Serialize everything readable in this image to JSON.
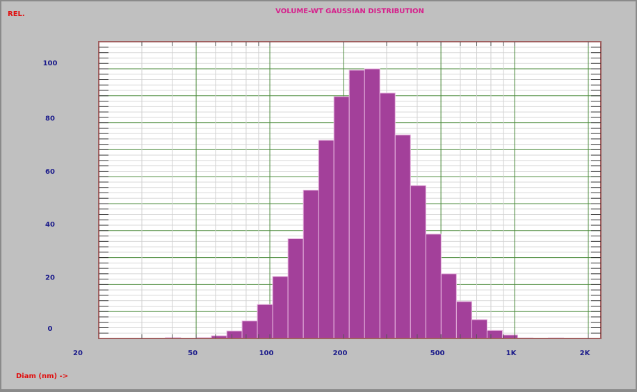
{
  "chart_data": {
    "type": "bar",
    "title": "VOLUME-WT GAUSSIAN DISTRIBUTION",
    "ylabel": "REL.",
    "xlabel": "Diam (nm) ->",
    "xscale": "log",
    "xlim": [
      20,
      2250
    ],
    "ylim": [
      0,
      110
    ],
    "yticks": [
      0,
      20,
      40,
      60,
      80,
      100
    ],
    "ytick_labels": [
      "0",
      "20",
      "40",
      "60",
      "80",
      "100"
    ],
    "xticks": [
      20,
      50,
      100,
      200,
      500,
      1000,
      2000
    ],
    "xtick_labels": [
      "20",
      "50",
      "100",
      "200",
      "500",
      "1K",
      "2K"
    ],
    "grid": true,
    "bar_color": "#a3409a",
    "title_color": "#d6208c",
    "axis_label_color": "#e01010",
    "tick_label_color": "#1a1a8a",
    "grid_major_color": "#4a8a3a",
    "bins": [
      {
        "from": 37.4,
        "to": 43.2,
        "value": 0.3
      },
      {
        "from": 50.0,
        "to": 57.7,
        "value": 0.3
      },
      {
        "from": 57.7,
        "to": 66.7,
        "value": 1.0
      },
      {
        "from": 66.7,
        "to": 77.0,
        "value": 2.8
      },
      {
        "from": 77.0,
        "to": 88.9,
        "value": 6.5
      },
      {
        "from": 88.9,
        "to": 102.7,
        "value": 12.6
      },
      {
        "from": 102.7,
        "to": 118.6,
        "value": 23.0
      },
      {
        "from": 118.6,
        "to": 137.0,
        "value": 37.0
      },
      {
        "from": 137.0,
        "to": 158.2,
        "value": 55.0
      },
      {
        "from": 158.2,
        "to": 182.7,
        "value": 73.5
      },
      {
        "from": 182.7,
        "to": 211.0,
        "value": 89.7
      },
      {
        "from": 211.0,
        "to": 243.7,
        "value": 99.5
      },
      {
        "from": 243.7,
        "to": 281.5,
        "value": 100.0
      },
      {
        "from": 281.5,
        "to": 325.1,
        "value": 91.0
      },
      {
        "from": 325.1,
        "to": 375.5,
        "value": 75.5
      },
      {
        "from": 375.5,
        "to": 433.7,
        "value": 56.7
      },
      {
        "from": 433.7,
        "to": 500.9,
        "value": 38.7
      },
      {
        "from": 500.9,
        "to": 578.5,
        "value": 24.0
      },
      {
        "from": 578.5,
        "to": 668.2,
        "value": 13.7
      },
      {
        "from": 668.2,
        "to": 771.7,
        "value": 7.0
      },
      {
        "from": 771.7,
        "to": 891.3,
        "value": 3.0
      },
      {
        "from": 891.3,
        "to": 1029.4,
        "value": 1.3
      },
      {
        "from": 1029.4,
        "to": 1189.0,
        "value": 0.2
      },
      {
        "from": 1373.0,
        "to": 1586.0,
        "value": 0.2
      }
    ]
  }
}
